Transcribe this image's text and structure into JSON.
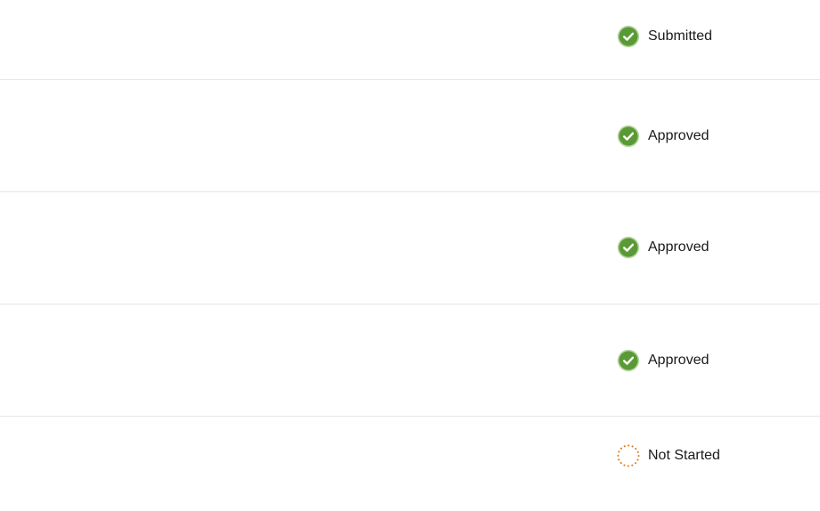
{
  "colors": {
    "complete": "#5a9a36",
    "complete_border": "#b9d6a6",
    "not_started": "#e07a1f",
    "divider": "#e6e6e6"
  },
  "rows": [
    {
      "status_label": "Submitted",
      "status_kind": "complete",
      "icon": "check-circle-icon"
    },
    {
      "status_label": "Approved",
      "status_kind": "complete",
      "icon": "check-circle-icon"
    },
    {
      "status_label": "Approved",
      "status_kind": "complete",
      "icon": "check-circle-icon"
    },
    {
      "status_label": "Approved",
      "status_kind": "complete",
      "icon": "check-circle-icon"
    },
    {
      "status_label": "Not Started",
      "status_kind": "not_started",
      "icon": "dotted-circle-icon"
    }
  ]
}
